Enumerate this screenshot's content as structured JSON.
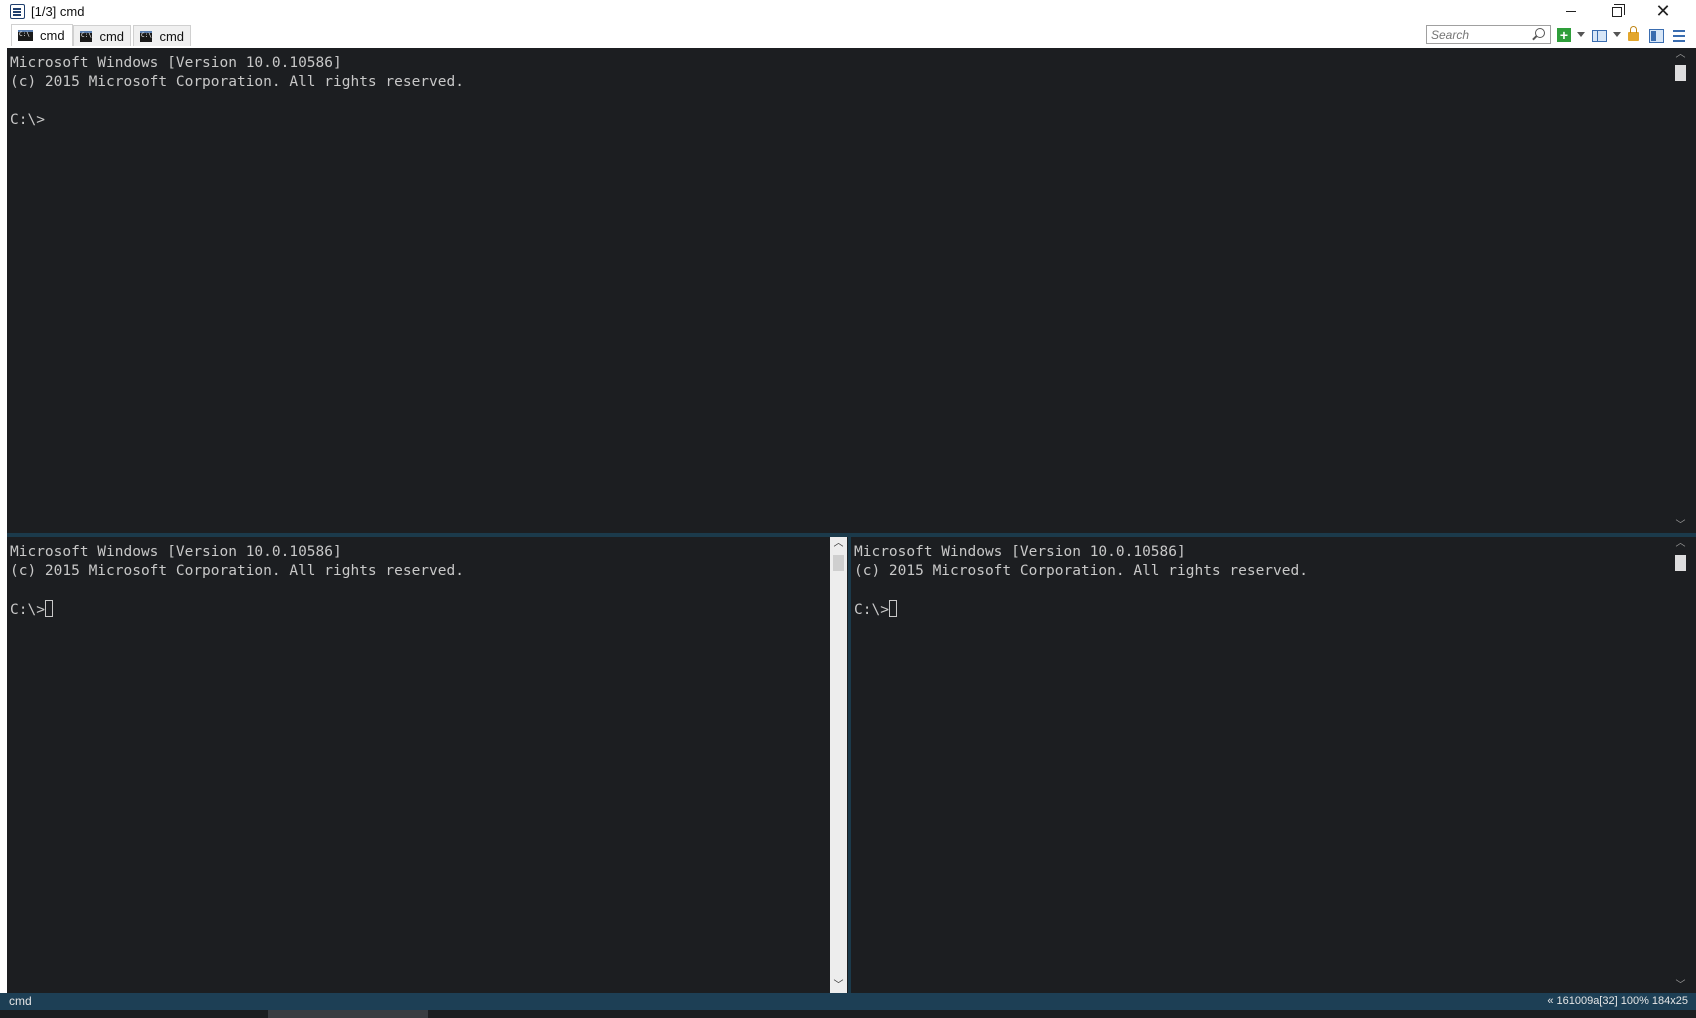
{
  "window": {
    "title": "[1/3] cmd"
  },
  "tabs": [
    {
      "label": "cmd",
      "active": true
    },
    {
      "label": "cmd",
      "active": false
    },
    {
      "label": "cmd",
      "active": false
    }
  ],
  "toolbar": {
    "search_placeholder": "Search",
    "icons": [
      "add-console-icon",
      "dropdown-arrow-icon",
      "layout-icon",
      "dropdown-arrow-icon",
      "lock-icon",
      "pane-toggle-icon",
      "menu-icon"
    ]
  },
  "panes": {
    "top": {
      "line1": "Microsoft Windows [Version 10.0.10586]",
      "line2": "(c) 2015 Microsoft Corporation. All rights reserved.",
      "prompt": "C:\\>"
    },
    "bottom_left": {
      "line1": "Microsoft Windows [Version 10.0.10586]",
      "line2": "(c) 2015 Microsoft Corporation. All rights reserved.",
      "prompt": "C:\\>"
    },
    "bottom_right": {
      "line1": "Microsoft Windows [Version 10.0.10586]",
      "line2": "(c) 2015 Microsoft Corporation. All rights reserved.",
      "prompt": "C:\\>"
    }
  },
  "statusbar": {
    "left": "cmd",
    "right": "« 161009a[32] 100% 184x25"
  },
  "colors": {
    "console_bg": "#1c1e21",
    "console_text": "#c8c8c8",
    "splitter": "#1b3a4b",
    "statusbar_bg": "#1d3f55"
  }
}
